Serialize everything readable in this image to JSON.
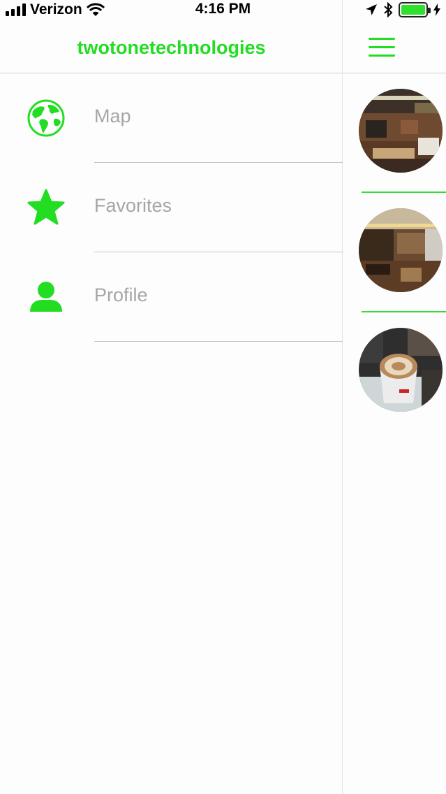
{
  "status_bar": {
    "carrier": "Verizon",
    "time": "4:16 PM",
    "battery_level": 1.0,
    "battery_color": "#2de12d"
  },
  "header": {
    "title": "twotonetechnologies"
  },
  "theme": {
    "accent": "#22dd22",
    "menu_text": "#a6a6a6",
    "divider": "#c6c6c6"
  },
  "menu": {
    "items": [
      {
        "label": "Map",
        "icon": "globe-icon"
      },
      {
        "label": "Favorites",
        "icon": "star-icon"
      },
      {
        "label": "Profile",
        "icon": "person-icon"
      }
    ]
  },
  "right_panel": {
    "menu_icon": "hamburger-icon",
    "thumbnails": [
      {
        "subject": "restaurant interior photo"
      },
      {
        "subject": "cafe interior photo"
      },
      {
        "subject": "latte art coffee cup photo"
      }
    ]
  }
}
